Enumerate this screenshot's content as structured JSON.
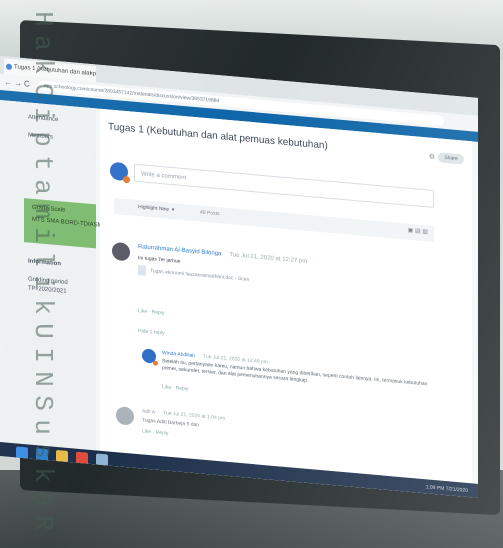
{
  "browser": {
    "tab_title": "Tugas 1 (Kebutuhan dan alat pe",
    "tab_close": "×",
    "url": "app.schoology.com/course/2603457142/materials/discussion/view/3653719884",
    "nav": {
      "back": "←",
      "forward": "→",
      "reload": "C",
      "home": "⌂"
    }
  },
  "sidebar": {
    "items": [
      "Attendance",
      "Members"
    ],
    "box_items": [
      "Grade Scale",
      "MTS SMA BORD-TDIASM"
    ],
    "info_heading": "Information",
    "info_lines": [
      "Grading period",
      "TP. 2020/2021"
    ]
  },
  "discussion": {
    "title": "Tugas 1 (Kebutuhan dan alat pemuas kebutuhan)",
    "title_button": "Share",
    "compose_placeholder": "Write a comment",
    "filter_label": "Highlight New",
    "posts_count": "49 Posts",
    "post1": {
      "author": "Raturrahman Al-Basyid Bilonga",
      "timestamp": "Tue Jul 21, 2020 at 12:27 pm",
      "text": "Ini tugas Ter jarhue",
      "attachment": "Tugas ekonomi fauzanramadhani.doc - Scan",
      "actions": "Like · Reply",
      "replies_toggle": "Hide 1 reply"
    },
    "reply": {
      "author": "Winda Abdillah",
      "timestamp": "Tue Jul 21, 2020 at 12:46 pm",
      "text": "Setelah itu, pertanyaan kamu, namun bahwa kebutuhan yang diberikan, seperti contoh lainnya. Ini, termasuk kebutuhan primer, sekunder, tersier, dan alat pemenuhannya secara lengkap.",
      "actions": "Like · Reply"
    },
    "post2": {
      "author": "Adit A",
      "timestamp": "Tue Jul 21, 2020 at 1:04 pm",
      "text": "Tugas Aditi Barbeja 5 dan",
      "actions": "Like · Reply"
    }
  },
  "taskbar": {
    "clock": "1:09 PM",
    "date": "7/21/2020"
  },
  "watermark": [
    "H",
    "a",
    "k",
    "C",
    "i",
    "p",
    "t",
    "a",
    "m",
    "i",
    "l",
    "i",
    "k",
    "U",
    "I",
    "N",
    "S",
    "u",
    "s",
    "k",
    "a",
    "R"
  ]
}
